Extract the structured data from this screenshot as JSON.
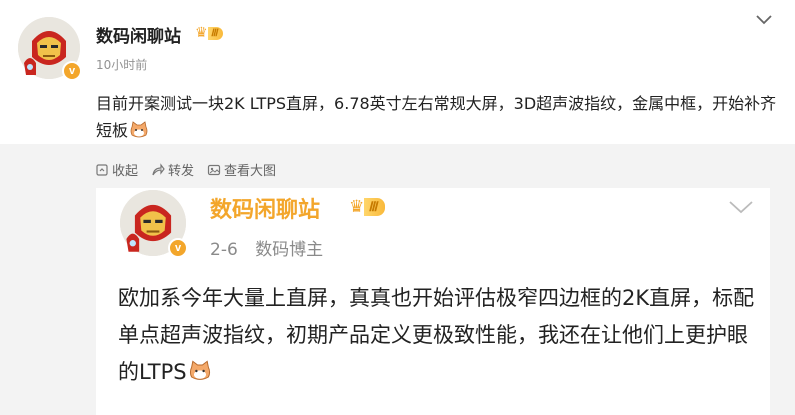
{
  "post": {
    "author": "数码闲聊站",
    "level_badge": "Ⅲ",
    "time": "10小时前",
    "text": "目前开案测试一块2K LTPS直屏，6.78英寸左右常规大屏，3D超声波指纹，金属中框，开始补齐短板",
    "verified_badge": "v",
    "actions": {
      "collapse": "收起",
      "forward": "转发",
      "view_large": "查看大图"
    }
  },
  "repost": {
    "author": "数码闲聊站",
    "level_badge": "Ⅲ",
    "date": "2-6",
    "source": "数码博主",
    "verified_badge": "v",
    "text": "欧加系今年大量上直屏，真真也开始评估极窄四边框的2K直屏，标配单点超声波指纹，初期产品定义更极致性能，我还在让他们上更护眼的LTPS"
  },
  "colors": {
    "accent": "#f3a62b",
    "text": "#222222",
    "meta": "#939393",
    "repost_bg": "#f3f3f3"
  },
  "icons": [
    "crown-icon",
    "chevron-down-icon",
    "collapse-icon",
    "forward-icon",
    "image-view-icon",
    "cat-emoji-icon",
    "verified-v-icon"
  ]
}
